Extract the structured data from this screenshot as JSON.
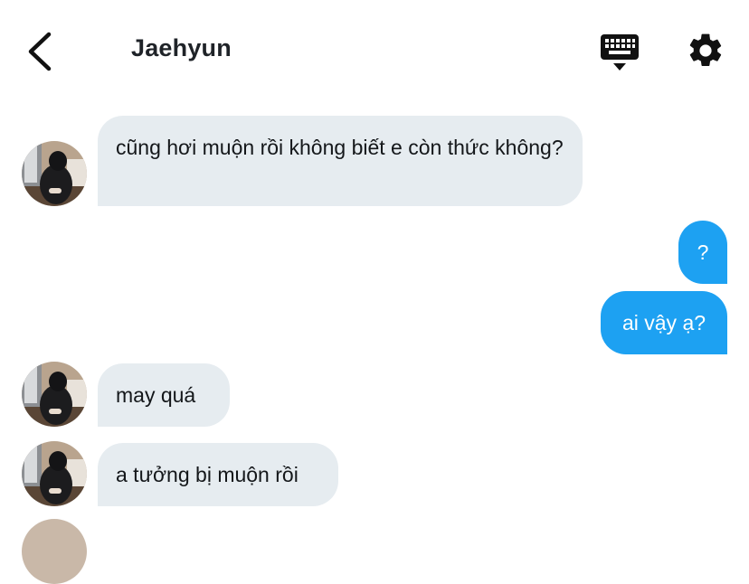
{
  "header": {
    "title": "Jaehyun",
    "back_icon": "chevron-left-icon",
    "keyboard_icon": "keyboard-icon",
    "settings_icon": "gear-icon"
  },
  "messages": [
    {
      "direction": "incoming",
      "text": "cũng hơi muộn rồi không biết e còn thức không?"
    },
    {
      "direction": "outgoing",
      "text": "?"
    },
    {
      "direction": "outgoing",
      "text": "ai vậy ạ?"
    },
    {
      "direction": "incoming",
      "text": "may quá"
    },
    {
      "direction": "incoming",
      "text": "a tưởng bị muộn rồi"
    }
  ],
  "colors": {
    "incoming_bubble": "#e6ecf0",
    "outgoing_bubble": "#1da1f2",
    "text": "#14171a"
  }
}
